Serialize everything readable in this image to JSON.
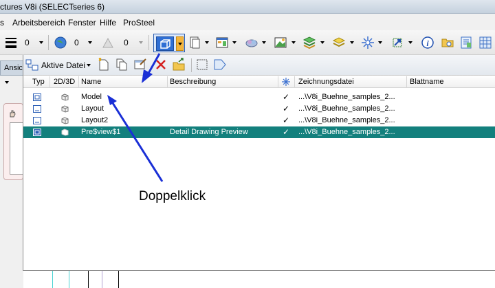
{
  "window": {
    "title": "ctures V8i (SELECTseries 6)"
  },
  "menu": {
    "items": [
      "s",
      "Arbeitsbereich",
      "Fenster",
      "Hilfe",
      "ProSteel"
    ]
  },
  "toolbar": {
    "value1": "0",
    "value2": "0",
    "value3": "0"
  },
  "left_panel": {
    "tab_label": "Ansic"
  },
  "dialog": {
    "source_label": "Aktive Datei",
    "columns": [
      "Typ",
      "2D/3D",
      "Name",
      "Beschreibung",
      "Zeichnungsdatei",
      "Blattname"
    ],
    "rows": [
      {
        "name": "Model",
        "description": "",
        "check": "✓",
        "file": "...\\V8i_Buehne_samples_2...",
        "sheet": ""
      },
      {
        "name": "Layout",
        "description": "",
        "check": "✓",
        "file": "...\\V8i_Buehne_samples_2...",
        "sheet": ""
      },
      {
        "name": "Layout2",
        "description": "",
        "check": "✓",
        "file": "...\\V8i_Buehne_samples_2...",
        "sheet": ""
      },
      {
        "name": "Pre$view$1",
        "description": "Detail Drawing Preview",
        "check": "✓",
        "file": "...\\V8i_Buehne_samples_2...",
        "sheet": "",
        "selected": true
      }
    ]
  },
  "annotation": {
    "text": "Doppelklick"
  },
  "colors": {
    "selection": "#13807d",
    "arrow": "#1a2fd6",
    "highlight_button": "#2f6fd4"
  }
}
